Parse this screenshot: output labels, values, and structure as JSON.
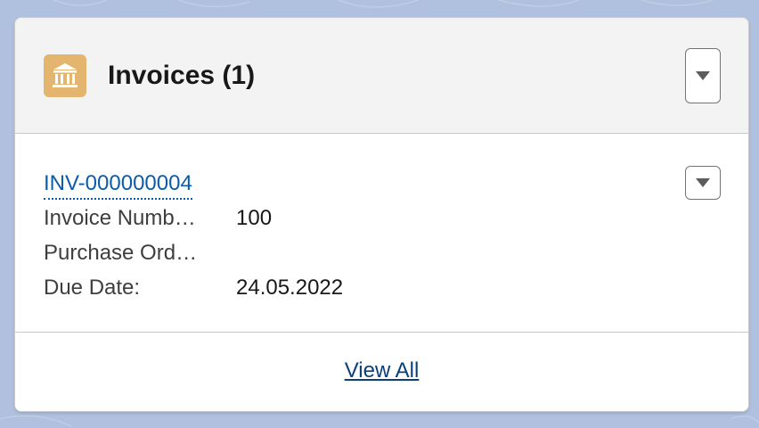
{
  "card": {
    "title": "Invoices (1)",
    "icon": "bank-icon",
    "icon_color": "#e3b56e"
  },
  "record": {
    "name": "INV-000000004",
    "fields": [
      {
        "label": "Invoice Numb…",
        "value": "100"
      },
      {
        "label": "Purchase Ord…",
        "value": ""
      },
      {
        "label": "Due Date:",
        "value": "24.05.2022"
      }
    ]
  },
  "footer": {
    "view_all_label": "View All"
  },
  "colors": {
    "link": "#0b5cab",
    "header_bg": "#f3f3f3",
    "page_bg": "#b0c1df"
  }
}
